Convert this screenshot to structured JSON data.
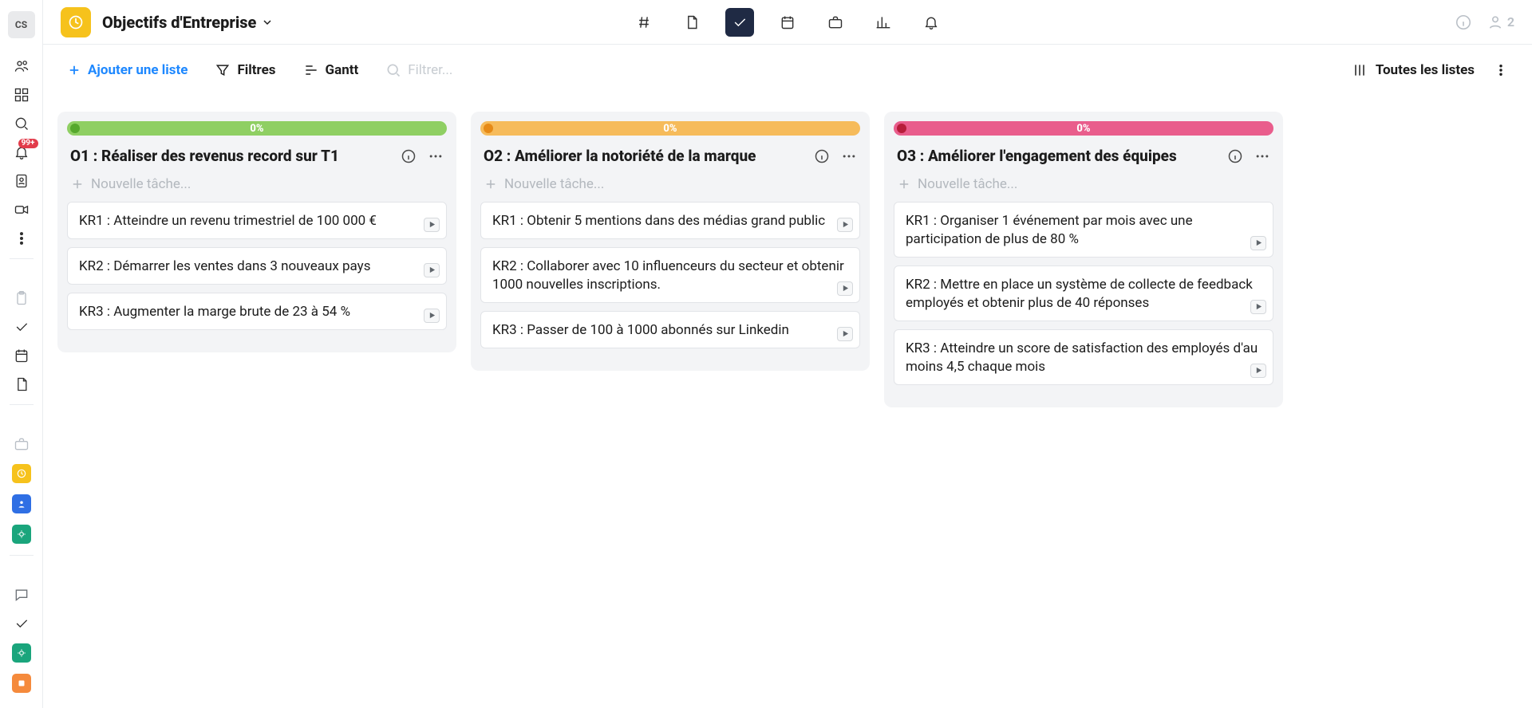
{
  "user": {
    "initials": "CS"
  },
  "board": {
    "title": "Objectifs d'Entreprise"
  },
  "notifications": {
    "badge": "99+"
  },
  "header_right": {
    "members_count": "2"
  },
  "toolbar": {
    "add_list": "Ajouter une liste",
    "filters": "Filtres",
    "gantt": "Gantt",
    "search_placeholder": "Filtrer...",
    "all_lists": "Toutes les listes"
  },
  "columns": [
    {
      "progress_text": "0%",
      "bar_color": "#8fcf63",
      "dot_color": "#56a82d",
      "title": "O1 : Réaliser des revenus record sur T1",
      "new_task": "Nouvelle tâche...",
      "cards": [
        "KR1 : Atteindre un revenu trimestriel de 100 000 €",
        "KR2 : Démarrer les ventes dans 3 nouveaux pays",
        "KR3 : Augmenter la marge brute de 23 à 54 %"
      ]
    },
    {
      "progress_text": "0%",
      "bar_color": "#f6bb5b",
      "dot_color": "#e68a17",
      "title": "O2 : Améliorer la notoriété de la marque",
      "new_task": "Nouvelle tâche...",
      "cards": [
        "KR1 : Obtenir 5 mentions dans des médias grand public",
        "KR2 : Collaborer avec 10 influenceurs du secteur et obtenir 1000 nouvelles inscriptions.",
        "KR3 : Passer de 100 à 1000 abonnés sur Linkedin"
      ]
    },
    {
      "progress_text": "0%",
      "bar_color": "#e95d8c",
      "dot_color": "#b71d3a",
      "title": "O3 : Améliorer l'engagement des équipes",
      "new_task": "Nouvelle tâche...",
      "cards": [
        "KR1 : Organiser 1 événement par mois avec une participation de plus de 80 %",
        "KR2 : Mettre en place un système de collecte de feedback employés et obtenir plus de 40 réponses",
        "KR3 : Atteindre un score de satisfaction des employés d'au moins 4,5 chaque mois"
      ]
    }
  ]
}
